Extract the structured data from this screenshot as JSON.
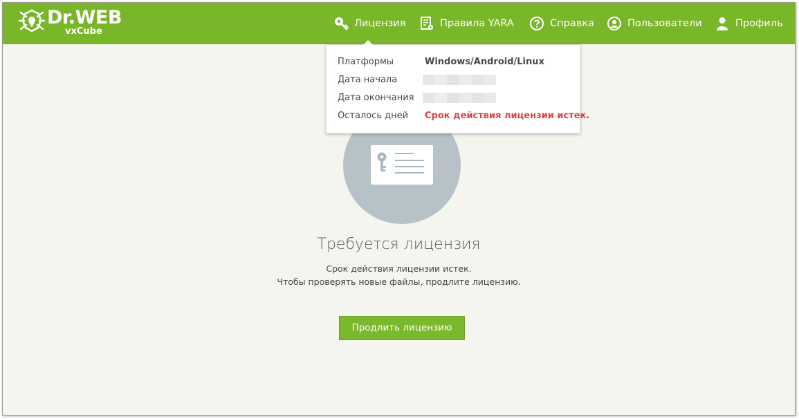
{
  "header": {
    "brand": "Dr.WEB",
    "product": "vxCube",
    "nav": {
      "license": "Лицензия",
      "yara": "Правила YARA",
      "help": "Справка",
      "users": "Пользователи",
      "profile": "Профиль"
    }
  },
  "popup": {
    "rows": [
      {
        "label": "Платформы",
        "value": "Windows/Android/Linux"
      },
      {
        "label": "Дата начала",
        "value": ""
      },
      {
        "label": "Дата окончания",
        "value": ""
      },
      {
        "label": "Осталось дней",
        "value": "Срок действия лицензии истек."
      }
    ]
  },
  "main": {
    "title": "Требуется лицензия",
    "message_line1": "Срок действия лицензии истек.",
    "message_line2": "Чтобы проверять новые файлы, продлите лицензию.",
    "renew_button": "Продлить лицензию"
  },
  "colors": {
    "header_bg": "#79b62a",
    "button_bg": "#7ab82c",
    "error_text": "#dd4444",
    "circle_bg": "#b6c2c8",
    "page_bg": "#f5f5f0"
  },
  "icons": {
    "license": "key-icon",
    "yara": "document-settings-icon",
    "help": "question-circle-icon",
    "users": "user-circle-icon",
    "profile": "user-icon",
    "main_illustration": "license-card-key-icon"
  }
}
